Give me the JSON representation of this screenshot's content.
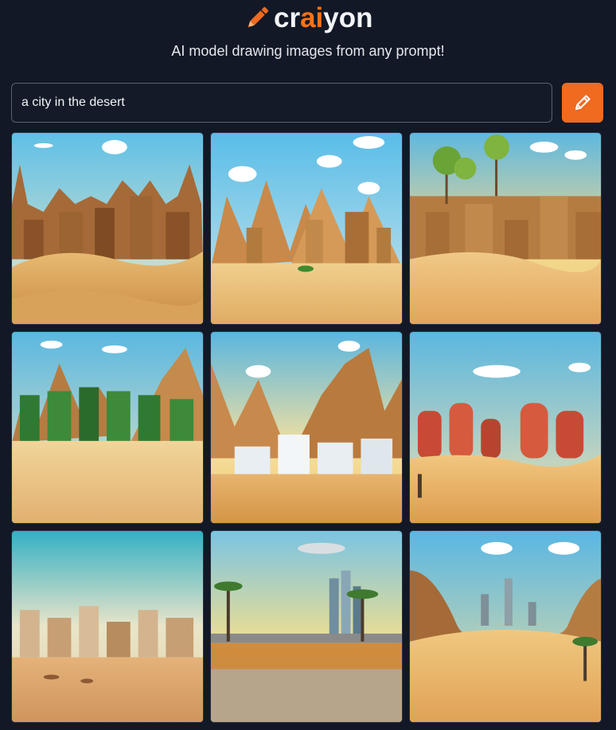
{
  "app": {
    "logo_prefix": "cr",
    "logo_ai": "ai",
    "logo_suffix": "yon",
    "tagline": "AI model drawing images from any prompt!",
    "accent_color": "#f06a1f",
    "background_color": "#121826"
  },
  "search": {
    "value": "a city in the desert",
    "button_icon": "pencil-icon"
  },
  "results": {
    "images": [
      {
        "id": 1,
        "alt": "a city in the desert"
      },
      {
        "id": 2,
        "alt": "a city in the desert"
      },
      {
        "id": 3,
        "alt": "a city in the desert"
      },
      {
        "id": 4,
        "alt": "a city in the desert"
      },
      {
        "id": 5,
        "alt": "a city in the desert"
      },
      {
        "id": 6,
        "alt": "a city in the desert"
      },
      {
        "id": 7,
        "alt": "a city in the desert"
      },
      {
        "id": 8,
        "alt": "a city in the desert"
      },
      {
        "id": 9,
        "alt": "a city in the desert"
      }
    ]
  }
}
